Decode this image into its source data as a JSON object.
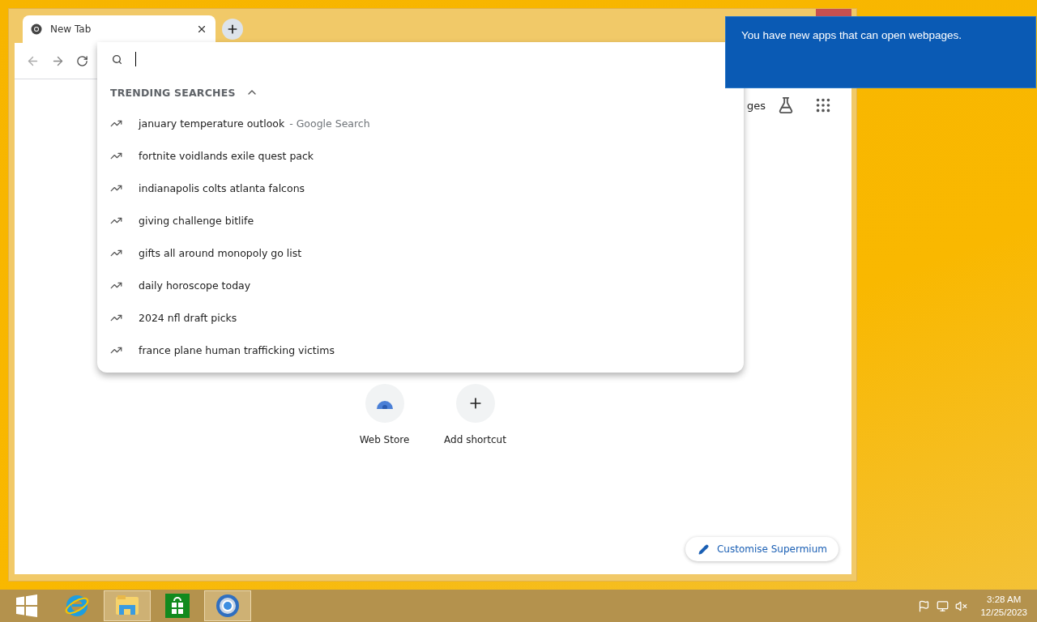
{
  "window": {
    "tab": {
      "title": "New Tab",
      "selected": true
    }
  },
  "suggestions": {
    "heading": "TRENDING SEARCHES",
    "expanded": true,
    "items": [
      {
        "text": "january temperature outlook",
        "detail": "- Google Search"
      },
      {
        "text": "fortnite voidlands exile quest pack"
      },
      {
        "text": "indianapolis colts atlanta falcons"
      },
      {
        "text": "giving challenge bitlife"
      },
      {
        "text": "gifts all around monopoly go list"
      },
      {
        "text": "daily horoscope today"
      },
      {
        "text": "2024 nfl draft picks"
      },
      {
        "text": "france plane human trafficking victims"
      }
    ]
  },
  "ntp": {
    "header_link": "ges",
    "shortcuts": [
      {
        "kind": "webstore",
        "label": "Web Store"
      },
      {
        "kind": "add",
        "label": "Add shortcut"
      }
    ],
    "customise": "Customise Supermium"
  },
  "notification": {
    "text": "You have new apps that can open webpages."
  },
  "taskbar": {
    "apps": [
      {
        "kind": "ie",
        "active": false
      },
      {
        "kind": "explorer",
        "active": true
      },
      {
        "kind": "store",
        "active": false
      },
      {
        "kind": "chrome",
        "active": true
      }
    ],
    "time": "3:28 AM",
    "date": "12/25/2023"
  }
}
